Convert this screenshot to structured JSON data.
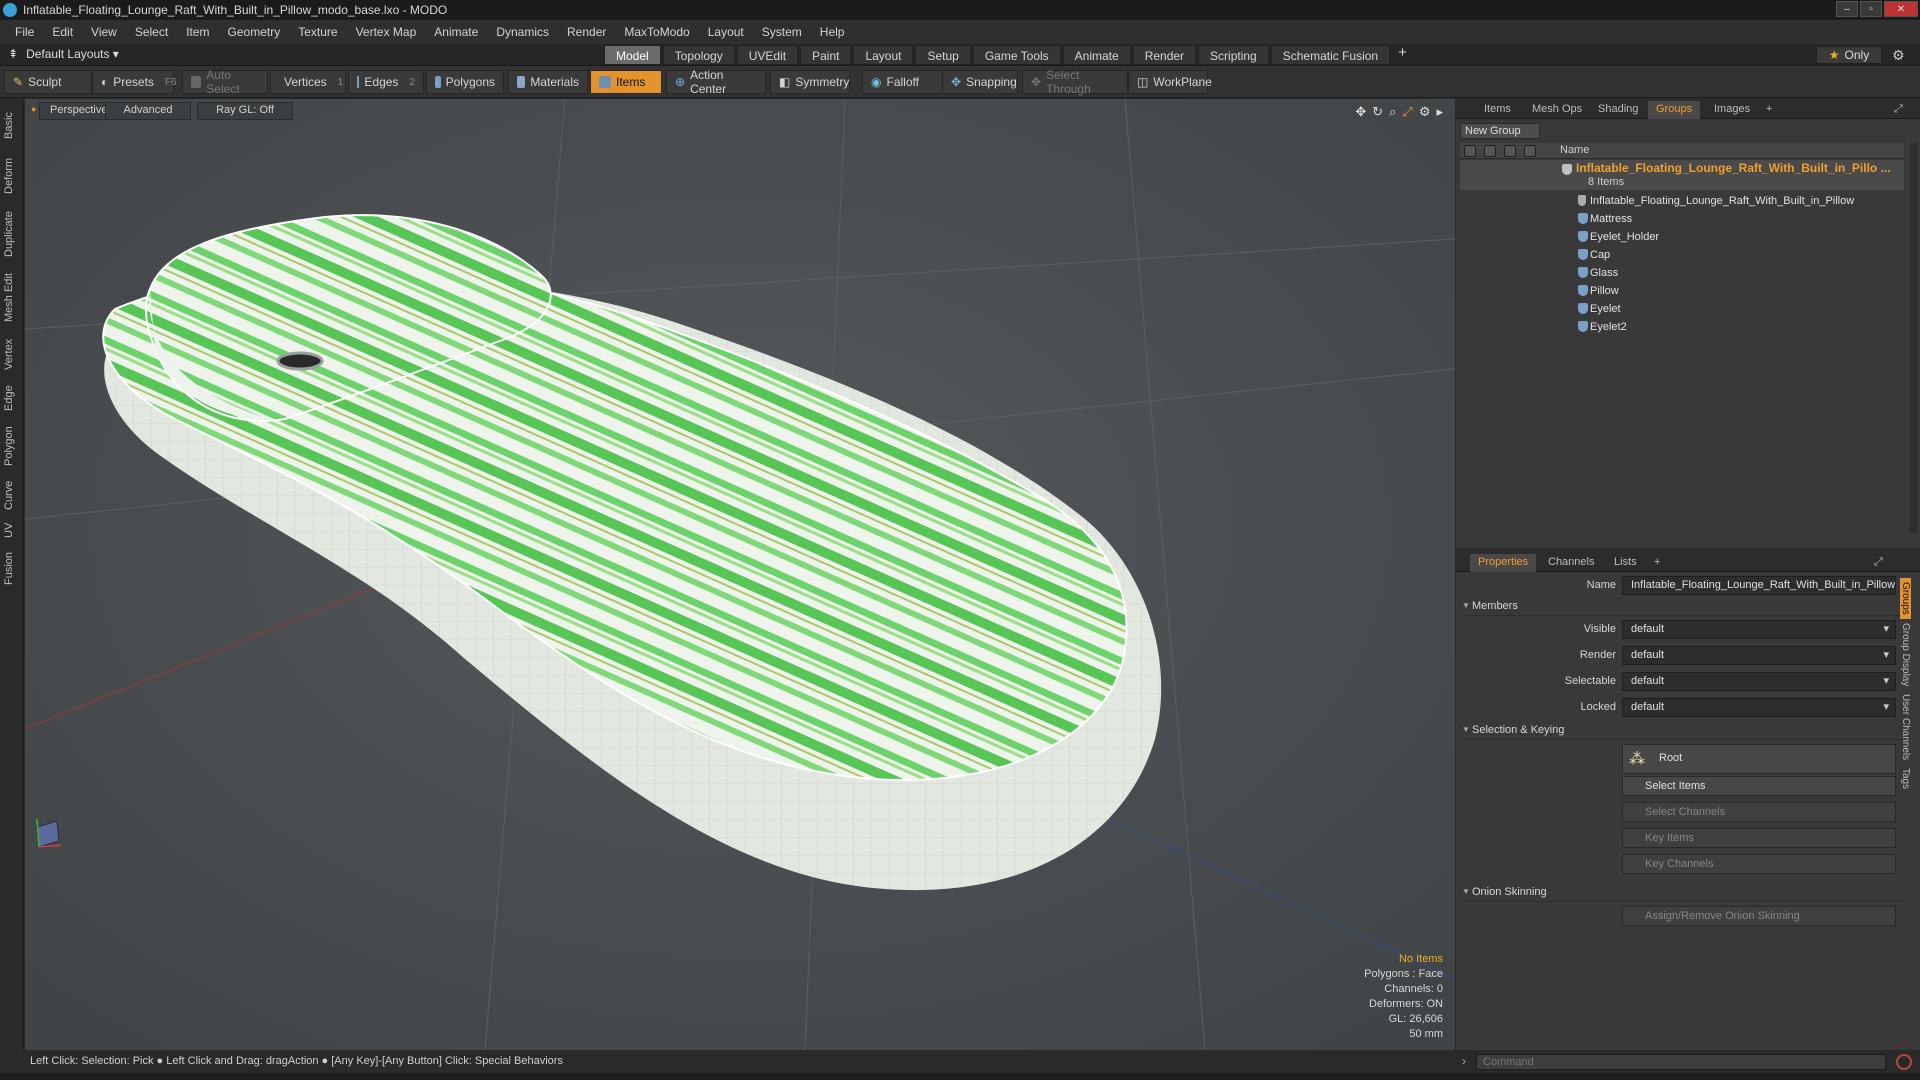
{
  "title_bar": {
    "title": "Inflatable_Floating_Lounge_Raft_With_Built_in_Pillow_modo_base.lxo - MODO",
    "buttons": [
      "–",
      "▫",
      "✕"
    ]
  },
  "menu": [
    "File",
    "Edit",
    "View",
    "Select",
    "Item",
    "Geometry",
    "Texture",
    "Vertex Map",
    "Animate",
    "Dynamics",
    "Render",
    "MaxToModo",
    "Layout",
    "System",
    "Help"
  ],
  "layout_bar": {
    "layouts_label": "Default Layouts ▾",
    "modes": [
      "Model",
      "Topology",
      "UVEdit",
      "Paint",
      "Layout",
      "Setup",
      "Game Tools",
      "Animate",
      "Render",
      "Scripting",
      "Schematic Fusion"
    ],
    "active_mode": "Model",
    "plus": "+",
    "only_label": "Only",
    "star": "★"
  },
  "toolbar": {
    "sculpt": "Sculpt",
    "presets": "Presets",
    "presets_key": "F6",
    "auto_select": "Auto Select",
    "vertices": "Vertices",
    "vertices_key": "1",
    "edges": "Edges",
    "edges_key": "2",
    "polygons": "Polygons",
    "materials": "Materials",
    "items": "Items",
    "action_center": "Action Center",
    "symmetry": "Symmetry",
    "falloff": "Falloff",
    "snapping": "Snapping",
    "select_through": "Select Through",
    "workplane": "WorkPlane"
  },
  "left_tabs": [
    "Basic",
    "Deform",
    "Duplicate",
    "Mesh Edit",
    "Vertex",
    "Edge",
    "Polygon",
    "Curve",
    "UV",
    "Fusion"
  ],
  "viewport": {
    "perspective": "Perspective",
    "advanced": "Advanced",
    "raygl": "Ray GL: Off",
    "info": {
      "no_items": "No Items",
      "polygons": "Polygons : Face",
      "channels": "Channels: 0",
      "deformers": "Deformers: ON",
      "gl": "GL: 26,606",
      "size": "50 mm"
    },
    "colors": {
      "bg": "#4a4f52",
      "stripe": "#6cd36a",
      "hull": "#e6ebe4"
    }
  },
  "groups_panel": {
    "tabs": [
      "Items",
      "Mesh Ops",
      "Shading",
      "Groups",
      "Images"
    ],
    "active_tab": "Groups",
    "new_group": "New Group",
    "column_name": "Name",
    "root": "Inflatable_Floating_Lounge_Raft_With_Built_in_Pillo ...",
    "count": "8 Items",
    "items": [
      "Inflatable_Floating_Lounge_Raft_With_Built_in_Pillow",
      "Mattress",
      "Eyelet_Holder",
      "Cap",
      "Glass",
      "Pillow",
      "Eyelet",
      "Eyelet2"
    ]
  },
  "properties_panel": {
    "tabs": [
      "Properties",
      "Channels",
      "Lists"
    ],
    "active_tab": "Properties",
    "name_label": "Name",
    "name_value": "Inflatable_Floating_Lounge_Raft_With_Built_in_Pillow",
    "members_section": "Members",
    "visible_label": "Visible",
    "visible_value": "default",
    "render_label": "Render",
    "render_value": "default",
    "selectable_label": "Selectable",
    "selectable_value": "default",
    "locked_label": "Locked",
    "locked_value": "default",
    "selection_section": "Selection & Keying",
    "root_btn": "Root",
    "select_items": "Select Items",
    "select_channels": "Select Channels",
    "key_items": "Key Items",
    "key_channels": "Key Channels",
    "onion_section": "Onion Skinning",
    "onion_btn": "Assign/Remove Onion Skinning",
    "side_tabs": [
      "Groups",
      "Group Display",
      "User Channels",
      "Tags"
    ]
  },
  "status_bar": {
    "text": "Left Click: Selection: Pick ● Left Click and Drag: dragAction ● [Any Key]-[Any Button] Click: Special Behaviors",
    "command_placeholder": "Command"
  }
}
